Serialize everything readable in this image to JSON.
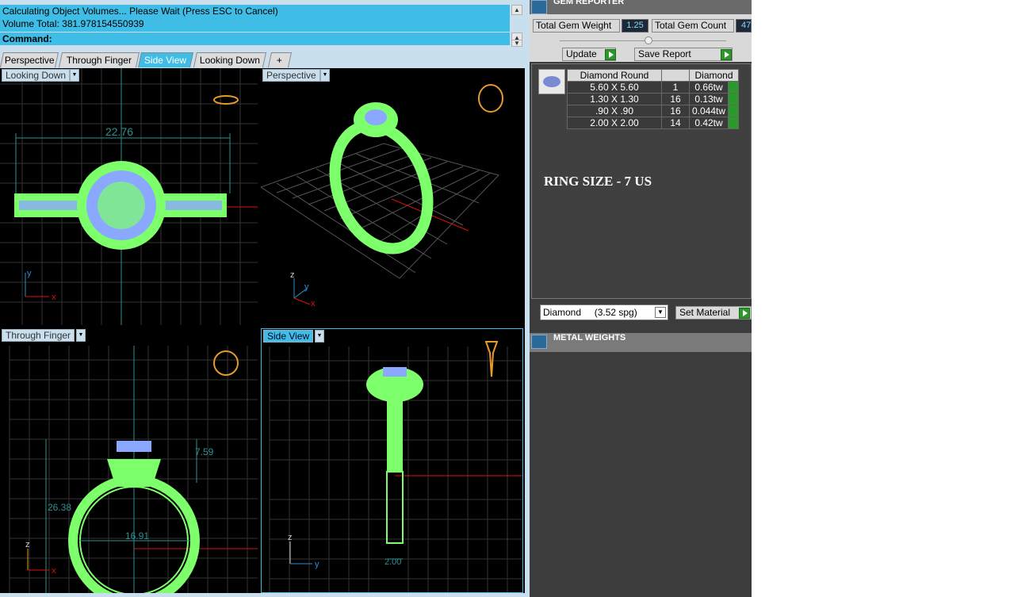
{
  "command": {
    "status_line1": "Calculating Object Volumes... Please Wait (Press ESC to Cancel)",
    "status_line2": "Volume Total: 381.978154550939",
    "prompt_label": "Command:"
  },
  "tabs": [
    "Perspective",
    "Through Finger",
    "Side View",
    "Looking Down",
    "+"
  ],
  "active_tab": "Side View",
  "viewports": {
    "top_left": {
      "label": "Looking Down",
      "dimension": "22.76",
      "axis_a": "y",
      "axis_b": "x"
    },
    "top_right": {
      "label": "Perspective",
      "axis_a": "z",
      "axis_b": "y",
      "axis_c": "x"
    },
    "bottom_left": {
      "label": "Through Finger",
      "dimension_inner": "16.91",
      "dimension_left": "26.38",
      "dimension_right": "7.59",
      "axis_a": "z",
      "axis_b": "x"
    },
    "bottom_right": {
      "label": "Side View",
      "dimension": "2.00",
      "axis_a": "z",
      "axis_b": "y"
    }
  },
  "gem_reporter": {
    "title": "GEM REPORTER",
    "total_weight_label": "Total Gem Weight",
    "total_weight_value": "1.25",
    "total_count_label": "Total Gem Count",
    "total_count_value": "47",
    "update_label": "Update",
    "save_label": "Save Report",
    "table_header": [
      "Diamond Round",
      "",
      "Diamond"
    ],
    "rows": [
      {
        "size": "5.60 X 5.60",
        "count": "1",
        "weight": "0.66tw"
      },
      {
        "size": "1.30 X 1.30",
        "count": "16",
        "weight": "0.13tw"
      },
      {
        "size": ".90 X .90",
        "count": "16",
        "weight": "0.044tw"
      },
      {
        "size": "2.00 X 2.00",
        "count": "14",
        "weight": "0.42tw"
      }
    ],
    "ring_size_note": "RING SIZE - 7 US",
    "material_value": "Diamond     (3.52 spg)",
    "set_material_label": "Set Material"
  },
  "metal_weights": {
    "title": "METAL WEIGHTS"
  },
  "colors": {
    "accent": "#3fbde6",
    "wire": "#7dff6b",
    "gem": "#8aa8ff",
    "grid": "#3a3a3a",
    "axis_red": "#e01010",
    "dim": "#2f8f8f"
  }
}
